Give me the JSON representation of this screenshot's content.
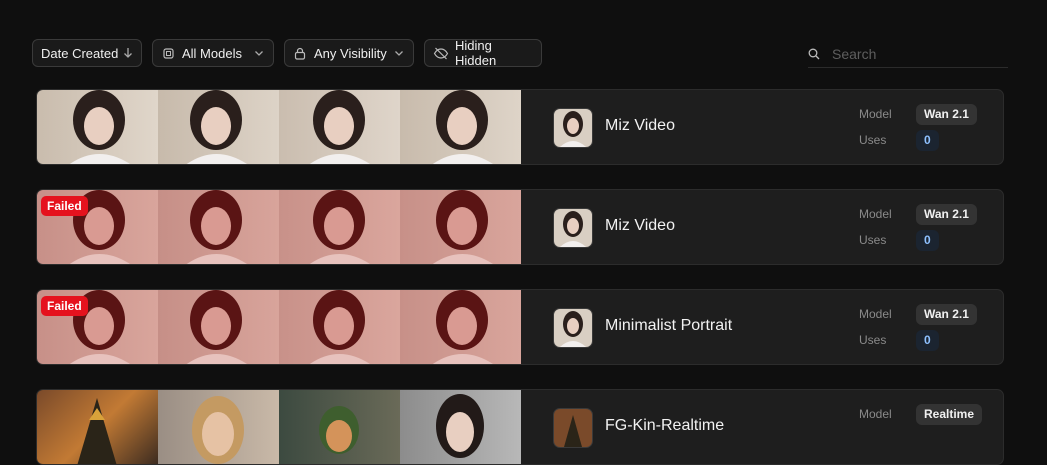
{
  "filters": {
    "sort": {
      "label": "Date Created",
      "icon": "arrow-down-icon"
    },
    "models": {
      "label": "All Models",
      "icon": "model-icon"
    },
    "visibility": {
      "label": "Any Visibility",
      "icon": "lock-icon"
    },
    "hidden": {
      "label": "Hiding Hidden",
      "icon": "eye-off-icon"
    }
  },
  "search": {
    "placeholder": "Search"
  },
  "labels": {
    "model": "Model",
    "uses": "Uses",
    "failed": "Failed"
  },
  "colors": {
    "failed": "#e5121e",
    "uses_text": "#8ec1ff"
  },
  "cards": [
    {
      "title": "Miz Video",
      "model": "Wan 2.1",
      "uses": "0",
      "failed": false
    },
    {
      "title": "Miz Video",
      "model": "Wan 2.1",
      "uses": "0",
      "failed": true
    },
    {
      "title": "Minimalist Portrait",
      "model": "Wan 2.1",
      "uses": "0",
      "failed": true
    },
    {
      "title": "FG-Kin-Realtime",
      "model": "Realtime",
      "uses": "",
      "failed": false
    }
  ]
}
